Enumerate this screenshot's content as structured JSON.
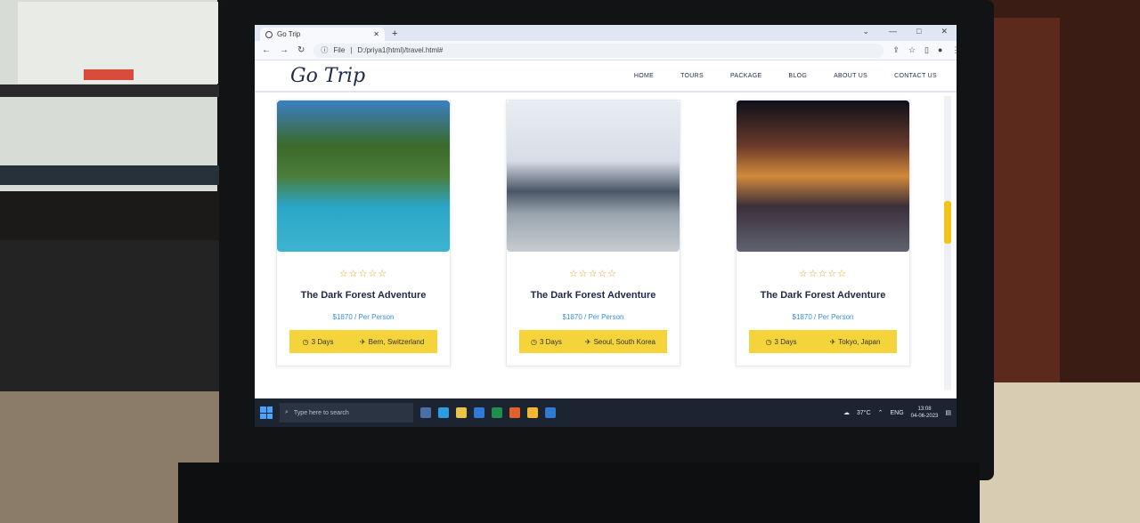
{
  "browser": {
    "tab_title": "Go Trip",
    "url_prefix": "File",
    "url": "D:/priya1(html)/travel.html#"
  },
  "site": {
    "logo": "Go Trip",
    "nav": [
      "HOME",
      "TOURS",
      "PACKAGE",
      "BLOG",
      "ABOUT US",
      "CONTACT US"
    ]
  },
  "cards": [
    {
      "title": "The Dark Forest Adventure",
      "stars": "☆☆☆☆☆",
      "price": "$1870 / Per Person",
      "days": "3 Days",
      "location": "Bern, Switzerland"
    },
    {
      "title": "The Dark Forest Adventure",
      "stars": "☆☆☆☆☆",
      "price": "$1870 / Per Person",
      "days": "3 Days",
      "location": "Seoul, South Korea"
    },
    {
      "title": "The Dark Forest Adventure",
      "stars": "☆☆☆☆☆",
      "price": "$1870 / Per Person",
      "days": "3 Days",
      "location": "Tokyo, Japan"
    }
  ],
  "taskbar": {
    "search_placeholder": "Type here to search",
    "weather": "37°C",
    "language": "ENG",
    "time": "13:08",
    "date": "04-06-2023"
  },
  "colors": {
    "accent_yellow": "#f5d33a",
    "price_blue": "#3a8dde",
    "heading_navy": "#1e2a4a"
  }
}
